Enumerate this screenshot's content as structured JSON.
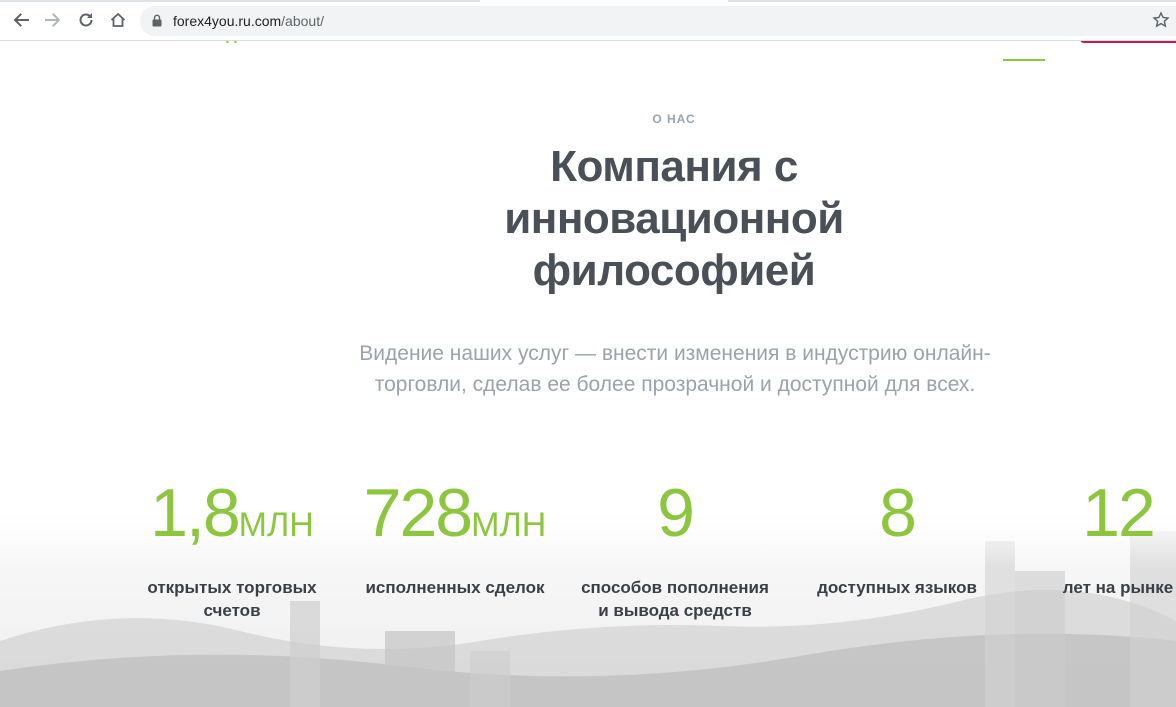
{
  "browser": {
    "url_domain": "forex4you.ru.com",
    "url_path": "/about/"
  },
  "about": {
    "eyebrow": "О НАС",
    "title": "Компания с инновационной философией",
    "lead": "Видение наших услуг — внести изменения в индустрию онлайн-торговли, сделав ее более прозрачной и доступной для всех."
  },
  "stats": [
    {
      "value": "1,8",
      "unit": "МЛН",
      "label": "открытых торговых счетов"
    },
    {
      "value": "728",
      "unit": "МЛН",
      "label": "исполненных сделок"
    },
    {
      "value": "9",
      "unit": "",
      "label": "способов пополнения и вывода средств"
    },
    {
      "value": "8",
      "unit": "",
      "label": "доступных языков"
    },
    {
      "value": "12",
      "unit": "",
      "label": "лет на рынке"
    }
  ],
  "colors": {
    "accent_green": "#8cc63f",
    "heading": "#4a5058",
    "muted": "#9aa2ab",
    "header_button": "#c2185b"
  }
}
